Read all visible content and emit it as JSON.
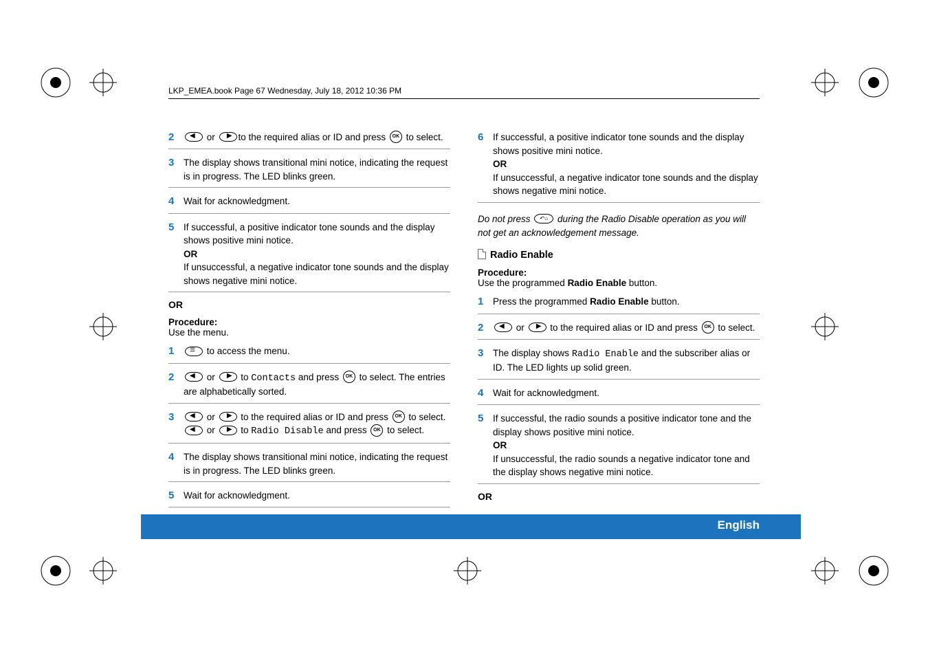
{
  "header": {
    "running": "LKP_EMEA.book  Page 67  Wednesday, July 18, 2012  10:36 PM"
  },
  "left": {
    "s2": {
      "text_a": " or ",
      "text_b": "to the required alias or ID and press ",
      "text_c": " to select."
    },
    "s3": "The display shows transitional mini notice, indicating the request is in progress. The LED blinks green.",
    "s4": "Wait for acknowledgment.",
    "s5": {
      "a": "If successful, a positive indicator tone sounds and the display shows positive mini notice.",
      "or": "OR",
      "b": "If unsuccessful, a negative indicator tone sounds and the display shows negative mini notice."
    },
    "or": "OR",
    "proc_hdr": "Procedure:",
    "proc_sub": "Use the menu.",
    "m1": " to access the menu.",
    "m2": {
      "a": " or ",
      "b": " to ",
      "mono": "Contacts",
      "c": " and press ",
      "d": " to select. The entries are alphabetically sorted."
    },
    "m3": {
      "a": " or ",
      "b": " to the required alias or ID and press ",
      "c": " to select.",
      "line2_a": " or ",
      "line2_b": " to ",
      "mono": "Radio Disable",
      "line2_c": " and press ",
      "line2_d": " to select."
    },
    "m4": " The display shows transitional mini notice, indicating the request is in progress. The LED blinks green.",
    "m5": "Wait for acknowledgment."
  },
  "right": {
    "s6": {
      "a": "If successful, a positive indicator tone sounds and the display shows positive mini notice.",
      "or": "OR",
      "b": "If unsuccessful, a negative indicator tone sounds and the display shows negative mini notice."
    },
    "note": {
      "a": "Do not press ",
      "b": " during the Radio Disable operation as you will not get an acknowledgement message."
    },
    "section": "Radio Enable",
    "proc_hdr": "Procedure:",
    "proc_sub_a": "Use the programmed ",
    "proc_sub_bold": "Radio Enable",
    "proc_sub_b": " button.",
    "r1": {
      "a": "Press the programmed ",
      "bold": "Radio Enable",
      "b": " button."
    },
    "r2": {
      "a": " or ",
      "b": " to the required alias or ID and press ",
      "c": " to select."
    },
    "r3": {
      "a": " The display shows ",
      "mono": "Radio Enable",
      "b": " and the subscriber alias or ID. The LED lights up solid green."
    },
    "r4": "Wait for acknowledgment.",
    "r5": {
      "a": "If successful, the radio sounds a positive indicator tone and the display shows positive mini notice.",
      "or": "OR",
      "b": "If unsuccessful, the radio sounds a negative indicator tone and the display shows negative mini notice."
    },
    "or": "OR"
  },
  "footer": {
    "page": "67",
    "lang": "English"
  },
  "nums": {
    "n1": "1",
    "n2": "2",
    "n3": "3",
    "n4": "4",
    "n5": "5",
    "n6": "6"
  }
}
